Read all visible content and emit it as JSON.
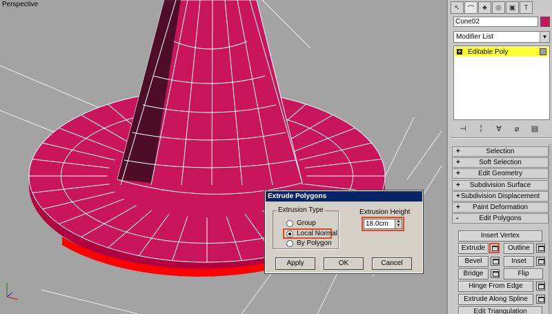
{
  "viewport": {
    "label": "Perspective",
    "object_color": "#c8155c",
    "edge_color": "#ffffff",
    "selected_face_color": "#ff0000",
    "background_color": "#a3a3a3",
    "grid_color": "#8a8a8a"
  },
  "command_panel": {
    "tabs": [
      {
        "name": "create-tab",
        "icon": "arrow-pointer-icon"
      },
      {
        "name": "modify-tab",
        "icon": "bend-arc-icon"
      },
      {
        "name": "hierarchy-tab",
        "icon": "hierarchy-icon"
      },
      {
        "name": "motion-tab",
        "icon": "motion-wheel-icon"
      },
      {
        "name": "display-tab",
        "icon": "monitor-icon"
      },
      {
        "name": "utilities-tab",
        "icon": "hammer-icon"
      }
    ],
    "object_name": "Cone02",
    "modifier_list_label": "Modifier List",
    "stack": [
      {
        "label": "Editable Poly"
      }
    ],
    "rollouts": [
      {
        "sign": "+",
        "label": "Selection"
      },
      {
        "sign": "+",
        "label": "Soft Selection"
      },
      {
        "sign": "+",
        "label": "Edit Geometry"
      },
      {
        "sign": "+",
        "label": "Subdivision Surface"
      },
      {
        "sign": "+",
        "label": "Subdivision Displacement"
      },
      {
        "sign": "+",
        "label": "Paint Deformation"
      },
      {
        "sign": "-",
        "label": "Edit Polygons"
      }
    ],
    "edit_polygons": {
      "insert_vertex": "Insert Vertex",
      "extrude": "Extrude",
      "outline": "Outline",
      "bevel": "Bevel",
      "inset": "Inset",
      "bridge": "Bridge",
      "flip": "Flip",
      "hinge_from_edge": "Hinge From Edge",
      "extrude_along_spline": "Extrude Along Spline",
      "edit_triangulation": "Edit Triangulation"
    }
  },
  "dialog": {
    "title": "Extrude Polygons",
    "extrusion_type_label": "Extrusion Type",
    "options": [
      {
        "label": "Group",
        "selected": false
      },
      {
        "label": "Local Normal",
        "selected": true
      },
      {
        "label": "By Polygon",
        "selected": false
      }
    ],
    "extrusion_height_label": "Extrusion Height",
    "extrusion_height_value": "18.0cm",
    "apply_label": "Apply",
    "ok_label": "OK",
    "cancel_label": "Cancel",
    "highlight_color": "#e04a22"
  }
}
